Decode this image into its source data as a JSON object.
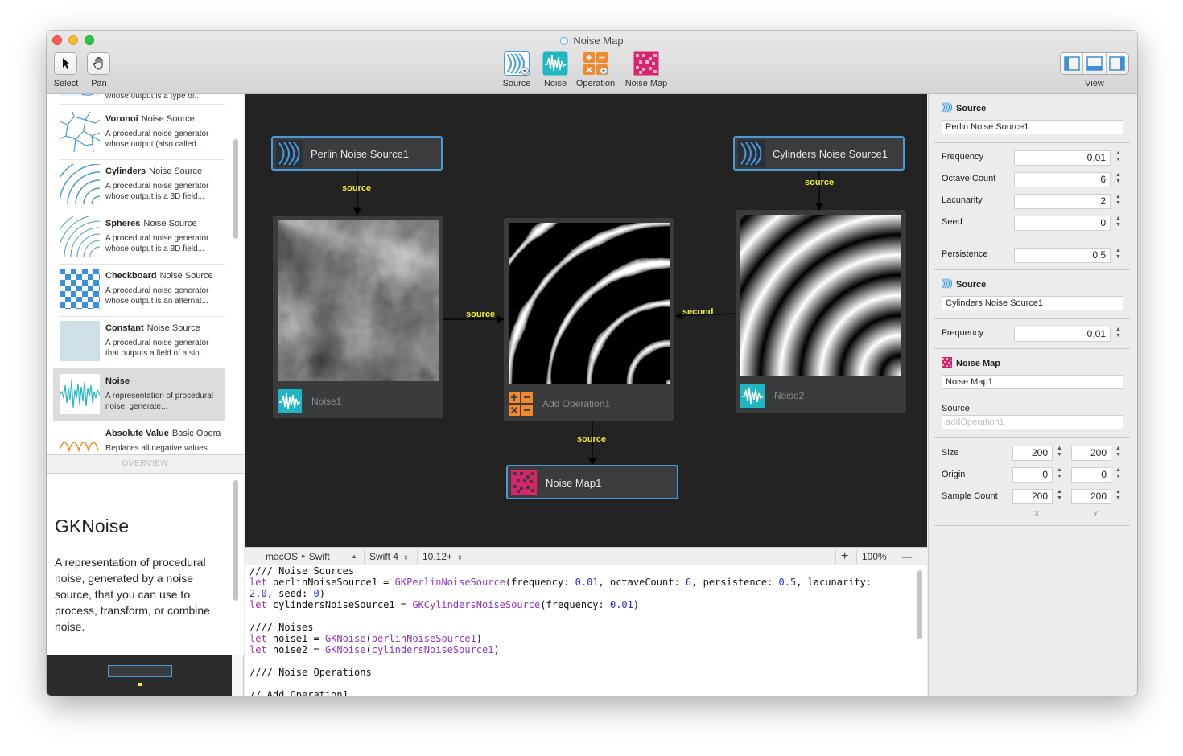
{
  "window": {
    "title": "Noise Map"
  },
  "toolbar": {
    "select_label": "Select",
    "pan_label": "Pan",
    "source_label": "Source",
    "noise_label": "Noise",
    "operation_label": "Operation",
    "noisemap_label": "Noise Map",
    "view_label": "View"
  },
  "library": {
    "items": [
      {
        "name": "",
        "kind": "",
        "desc": "whose output is a type of..."
      },
      {
        "name": "Voronoi",
        "kind": "Noise Source",
        "desc": "A procedural noise generator whose output (also called..."
      },
      {
        "name": "Cylinders",
        "kind": "Noise Source",
        "desc": "A procedural noise generator whose output is a 3D field..."
      },
      {
        "name": "Spheres",
        "kind": "Noise Source",
        "desc": "A procedural noise generator whose output is a 3D field..."
      },
      {
        "name": "Checkboard",
        "kind": "Noise Source",
        "desc": "A procedural noise generator whose output is an alternat..."
      },
      {
        "name": "Constant",
        "kind": "Noise Source",
        "desc": "A procedural noise generator that outputs a field of a sin..."
      },
      {
        "name": "Noise",
        "kind": "",
        "desc": "A representation of procedural noise, generate..."
      },
      {
        "name": "Absolute Value",
        "kind": "Basic Opera",
        "desc": "Replaces all negative values"
      }
    ],
    "overview_label": "OVERVIEW",
    "doc_title": "GKNoise",
    "doc_desc": "A representation of procedural noise, generated by a noise source, that you can use to process, transform, or combine noise."
  },
  "graph": {
    "nodes": {
      "perlin": {
        "title": "Perlin Noise Source1"
      },
      "cylinders": {
        "title": "Cylinders Noise Source1"
      },
      "noise1": {
        "title": "Noise1"
      },
      "noise2": {
        "title": "Noise2"
      },
      "addop": {
        "title": "Add Operation1"
      },
      "noisemap": {
        "title": "Noise Map1"
      }
    },
    "edges": {
      "e1": "source",
      "e2": "source",
      "e3": "source",
      "e4": "second",
      "e5": "source"
    }
  },
  "codebar": {
    "platform": "macOS ‣ Swift",
    "language": "Swift 4",
    "version": "10.12+",
    "zoom_in": "+",
    "zoom": "100%",
    "zoom_out": "—"
  },
  "code": {
    "lines": [
      "//// Noise Sources",
      "let perlinNoiseSource1 = GKPerlinNoiseSource(frequency: 0.01, octaveCount: 6, persistence: 0.5, lacunarity:",
      "2.0, seed: 0)",
      "let cylindersNoiseSource1 = GKCylindersNoiseSource(frequency: 0.01)",
      "",
      "//// Noises",
      "let noise1 = GKNoise(perlinNoiseSource1)",
      "let noise2 = GKNoise(cylindersNoiseSource1)",
      "",
      "//// Noise Operations",
      "",
      "// Add Operation1"
    ]
  },
  "inspector": {
    "source1": {
      "header": "Source",
      "name": "Perlin Noise Source1",
      "frequency_label": "Frequency",
      "frequency": "0,01",
      "octave_label": "Octave Count",
      "octave": "6",
      "lacunarity_label": "Lacunarity",
      "lacunarity": "2",
      "seed_label": "Seed",
      "seed": "0",
      "persistence_label": "Persistence",
      "persistence": "0,5"
    },
    "source2": {
      "header": "Source",
      "name": "Cylinders Noise Source1",
      "frequency_label": "Frequency",
      "frequency": "0,01"
    },
    "noisemap": {
      "header": "Noise Map",
      "name": "Noise Map1",
      "source_label": "Source",
      "source_placeholder": "addOperation1",
      "size_label": "Size",
      "size_x": "200",
      "size_y": "200",
      "origin_label": "Origin",
      "origin_x": "0",
      "origin_y": "0",
      "sample_label": "Sample Count",
      "sample_x": "200",
      "sample_y": "200",
      "x_label": "X",
      "y_label": "Y"
    }
  },
  "colors": {
    "accent": "#4a9ad6",
    "edge_label": "#f2ea3b",
    "noise_icon": "#1fb8c2",
    "operation_icon": "#f08a2c",
    "noisemap_icon": "#d8246c"
  }
}
